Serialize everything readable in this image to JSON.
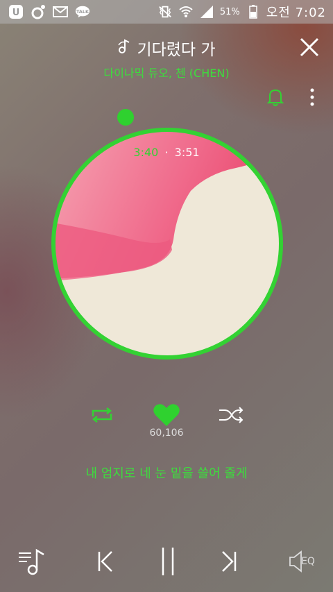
{
  "status_bar": {
    "left_icons": [
      "u-plus-icon",
      "o-app-icon",
      "mail-icon",
      "kakaotalk-icon"
    ],
    "talk_label": "TALK",
    "right_icons": [
      "vibrate-mute-icon",
      "wifi-icon",
      "signal-icon",
      "battery-icon"
    ],
    "battery": "51%",
    "time": "오전 7:02"
  },
  "player": {
    "title": "기다렸다 가",
    "artist": "다이나믹 듀오, 첸 (CHEN)",
    "current_time": "3:40",
    "separator": "·",
    "total_time": "3:51",
    "progress": 0.957,
    "like_count": "60,106",
    "lyric": "내 엄지로 네 눈 밑을 쓸어 줄게",
    "eq_label": "EQ"
  },
  "colors": {
    "accent": "#33d233",
    "text": "#ffffff"
  }
}
